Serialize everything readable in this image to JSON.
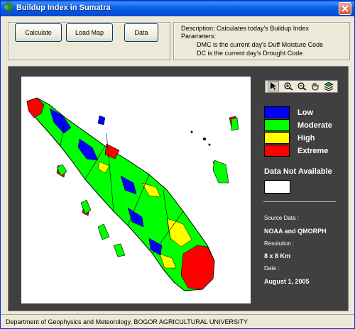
{
  "window": {
    "title": "Buildup Index in Sumatra"
  },
  "toolbar": {
    "calculate_label": "Calculate",
    "load_map_label": "Load Map",
    "data_label": "Data"
  },
  "description": {
    "line1": "Description: Calculates today's Buildup Index",
    "line2": "Parameters:",
    "line3": "DMC is the current day's Duff Moisture Code",
    "line4": "DC is the current day's Drought Code"
  },
  "map_tools": [
    "pointer-tool",
    "zoom-in-tool",
    "zoom-out-tool",
    "pan-tool",
    "layers-tool"
  ],
  "legend": {
    "items": [
      {
        "label": "Low",
        "color": "#0000ff"
      },
      {
        "label": "Moderate",
        "color": "#00ff00"
      },
      {
        "label": "High",
        "color": "#ffff00"
      },
      {
        "label": "Extreme",
        "color": "#ff0000"
      }
    ],
    "na_title": "Data Not Available",
    "na_color": "#ffffff"
  },
  "info": {
    "source_label": "Source Data :",
    "source_value": "NOAA and QMORPH",
    "resolution_label": "Resolution :",
    "resolution_value": "8 x 8 Km",
    "date_label": "Date :",
    "date_value": "August 1, 2005"
  },
  "status": {
    "text": "Department of Geophysics and Meteorology, BOGOR AGRICULTURAL UNIVERSITY"
  }
}
